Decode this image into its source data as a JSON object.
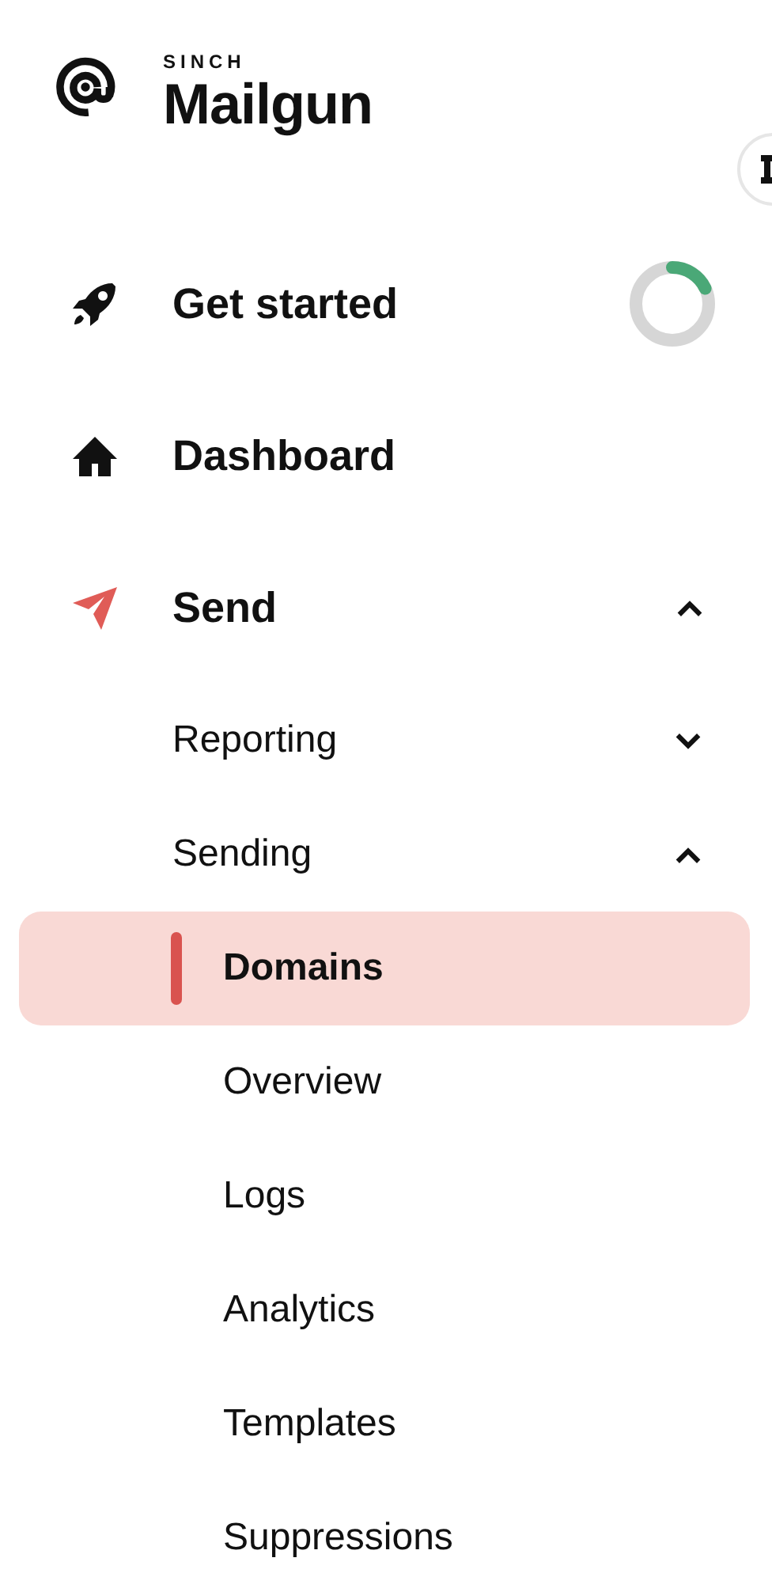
{
  "logo": {
    "brand": "SINCH",
    "product": "Mailgun"
  },
  "nav": [
    {
      "kind": "progress",
      "label": "Get started",
      "active": false,
      "level": 0.18
    },
    {
      "kind": "link",
      "label": "Dashboard",
      "active": false
    },
    {
      "kind": "group",
      "label": "Send",
      "active": true,
      "expanded": true,
      "children": [
        {
          "label": "Reporting",
          "expanded": false
        },
        {
          "label": "Sending",
          "expanded": true,
          "children": [
            {
              "label": "Domains",
              "selected": true
            },
            {
              "label": "Overview",
              "selected": false
            },
            {
              "label": "Logs",
              "selected": false
            },
            {
              "label": "Analytics",
              "selected": false
            },
            {
              "label": "Templates",
              "selected": false
            },
            {
              "label": "Suppressions",
              "selected": false
            }
          ]
        }
      ]
    }
  ]
}
